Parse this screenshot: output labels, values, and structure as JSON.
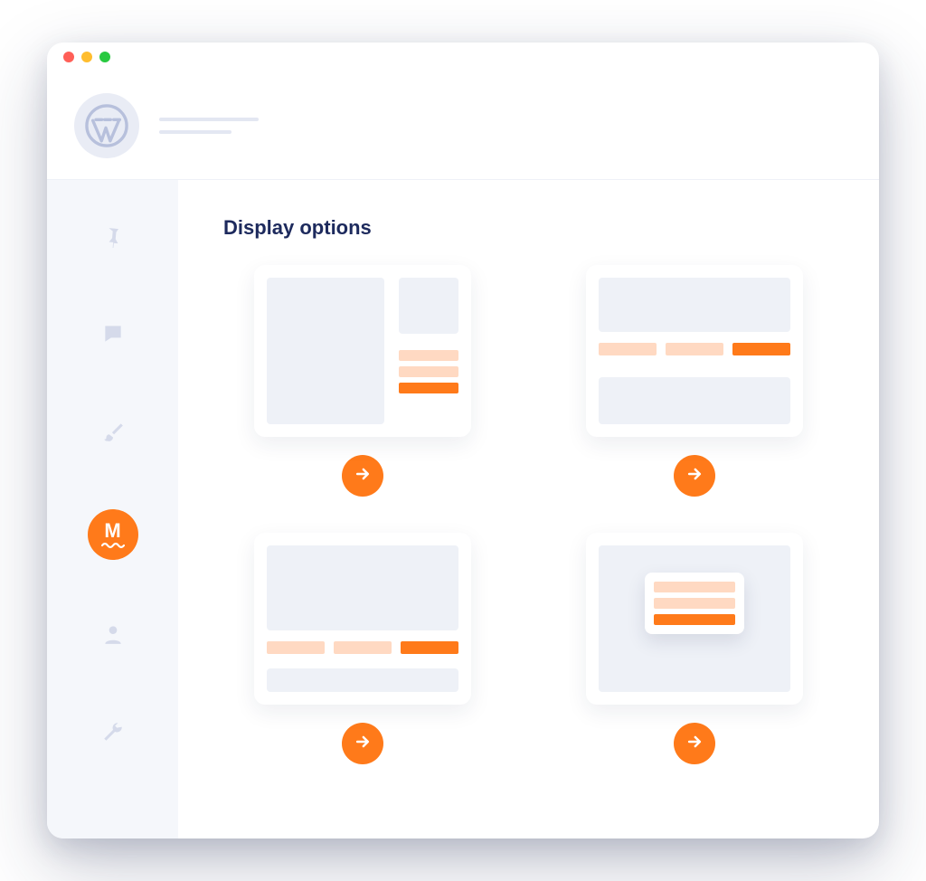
{
  "window": {
    "traffic": {
      "close": "close",
      "min": "minimize",
      "max": "maximize"
    }
  },
  "header": {
    "logo": "wordpress-logo"
  },
  "sidebar": {
    "items": [
      {
        "icon": "pin-icon",
        "active": false
      },
      {
        "icon": "comment-icon",
        "active": false
      },
      {
        "icon": "brush-icon",
        "active": false
      },
      {
        "icon": "m-logo-icon",
        "active": true,
        "letter": "M"
      },
      {
        "icon": "user-icon",
        "active": false
      },
      {
        "icon": "wrench-icon",
        "active": false
      }
    ]
  },
  "main": {
    "section_title": "Display options",
    "options": [
      {
        "id": "layout-sidebar",
        "action": "select"
      },
      {
        "id": "layout-banner-row",
        "action": "select"
      },
      {
        "id": "layout-banner-bottom",
        "action": "select"
      },
      {
        "id": "layout-popup",
        "action": "select"
      }
    ]
  },
  "colors": {
    "accent": "#ff7a1a",
    "accent_light": "#ffd9c2",
    "placeholder": "#eef1f7",
    "sidebar_bg": "#f5f7fb",
    "title": "#1d2a5d"
  }
}
